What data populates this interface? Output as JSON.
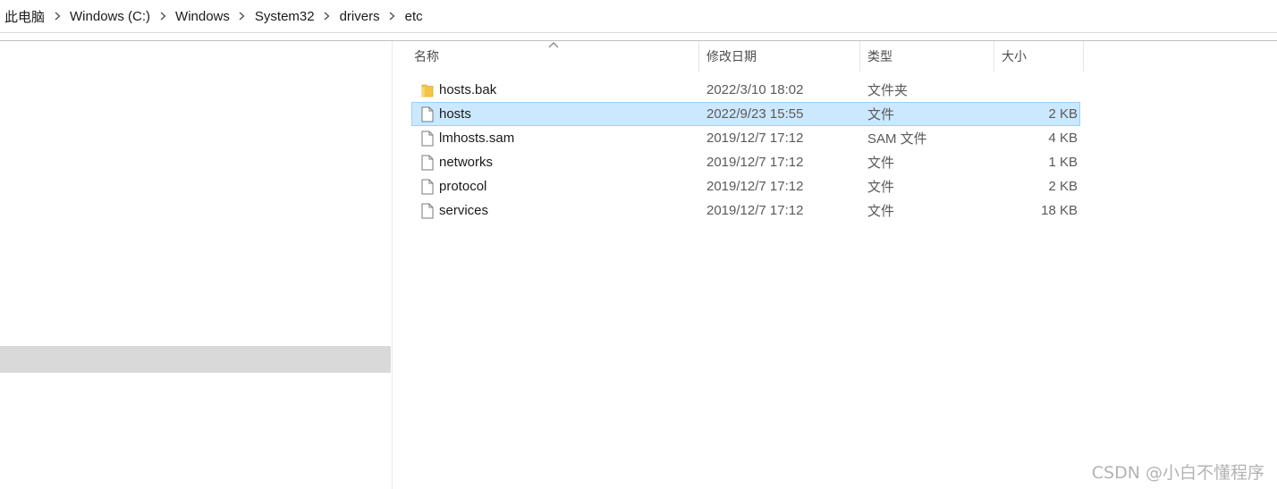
{
  "breadcrumb": {
    "items": [
      {
        "label": "此电脑"
      },
      {
        "label": "Windows (C:)"
      },
      {
        "label": "Windows"
      },
      {
        "label": "System32"
      },
      {
        "label": "drivers"
      },
      {
        "label": "etc"
      }
    ]
  },
  "columns": {
    "name": "名称",
    "date": "修改日期",
    "type": "类型",
    "size": "大小"
  },
  "files": [
    {
      "name": "hosts.bak",
      "date": "2022/3/10 18:02",
      "type": "文件夹",
      "size": "",
      "icon": "folder-icon"
    },
    {
      "name": "hosts",
      "date": "2022/9/23 15:55",
      "type": "文件",
      "size": "2 KB",
      "icon": "file-icon"
    },
    {
      "name": "lmhosts.sam",
      "date": "2019/12/7 17:12",
      "type": "SAM 文件",
      "size": "4 KB",
      "icon": "file-icon"
    },
    {
      "name": "networks",
      "date": "2019/12/7 17:12",
      "type": "文件",
      "size": "1 KB",
      "icon": "file-icon"
    },
    {
      "name": "protocol",
      "date": "2019/12/7 17:12",
      "type": "文件",
      "size": "2 KB",
      "icon": "file-icon"
    },
    {
      "name": "services",
      "date": "2019/12/7 17:12",
      "type": "文件",
      "size": "18 KB",
      "icon": "file-icon"
    }
  ],
  "selected_file": "hosts",
  "colors": {
    "selection_bg": "#cce8ff",
    "selection_border": "#99d1ff",
    "folder": "#f5c542"
  },
  "watermark": "CSDN @小白不懂程序"
}
